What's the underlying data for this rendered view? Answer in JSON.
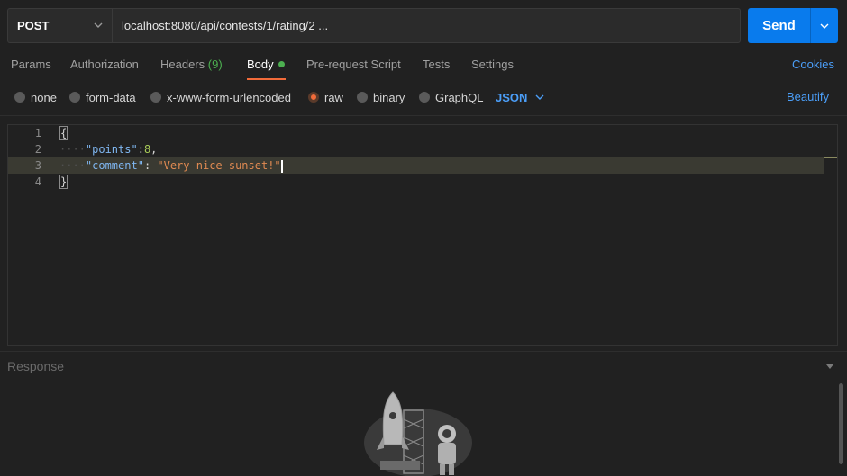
{
  "request": {
    "method": "POST",
    "url": "localhost:8080/api/contests/1/rating/2 ...",
    "send_label": "Send"
  },
  "tabs": [
    {
      "label": "Params"
    },
    {
      "label": "Authorization"
    },
    {
      "label": "Headers",
      "count": "(9)"
    },
    {
      "label": "Body"
    },
    {
      "label": "Pre-request Script"
    },
    {
      "label": "Tests"
    },
    {
      "label": "Settings"
    }
  ],
  "cookies_label": "Cookies",
  "body_types": [
    {
      "label": "none"
    },
    {
      "label": "form-data"
    },
    {
      "label": "x-www-form-urlencoded"
    },
    {
      "label": "raw",
      "selected": true
    },
    {
      "label": "binary"
    },
    {
      "label": "GraphQL"
    }
  ],
  "format_select": "JSON",
  "beautify_label": "Beautify",
  "editor": {
    "line_numbers": [
      "1",
      "2",
      "3",
      "4"
    ],
    "open_brace": "{",
    "close_brace": "}",
    "line2": {
      "key": "\"points\"",
      "sep": ":",
      "value": "8",
      "trail": ","
    },
    "line3": {
      "key": "\"comment\"",
      "sep": ": ",
      "value": "\"Very nice sunset!\""
    }
  },
  "response_label": "Response",
  "colors": {
    "accent_blue": "#097bed",
    "active_tab_underline": "#f26b3a",
    "body_dot": "#4caf50"
  }
}
